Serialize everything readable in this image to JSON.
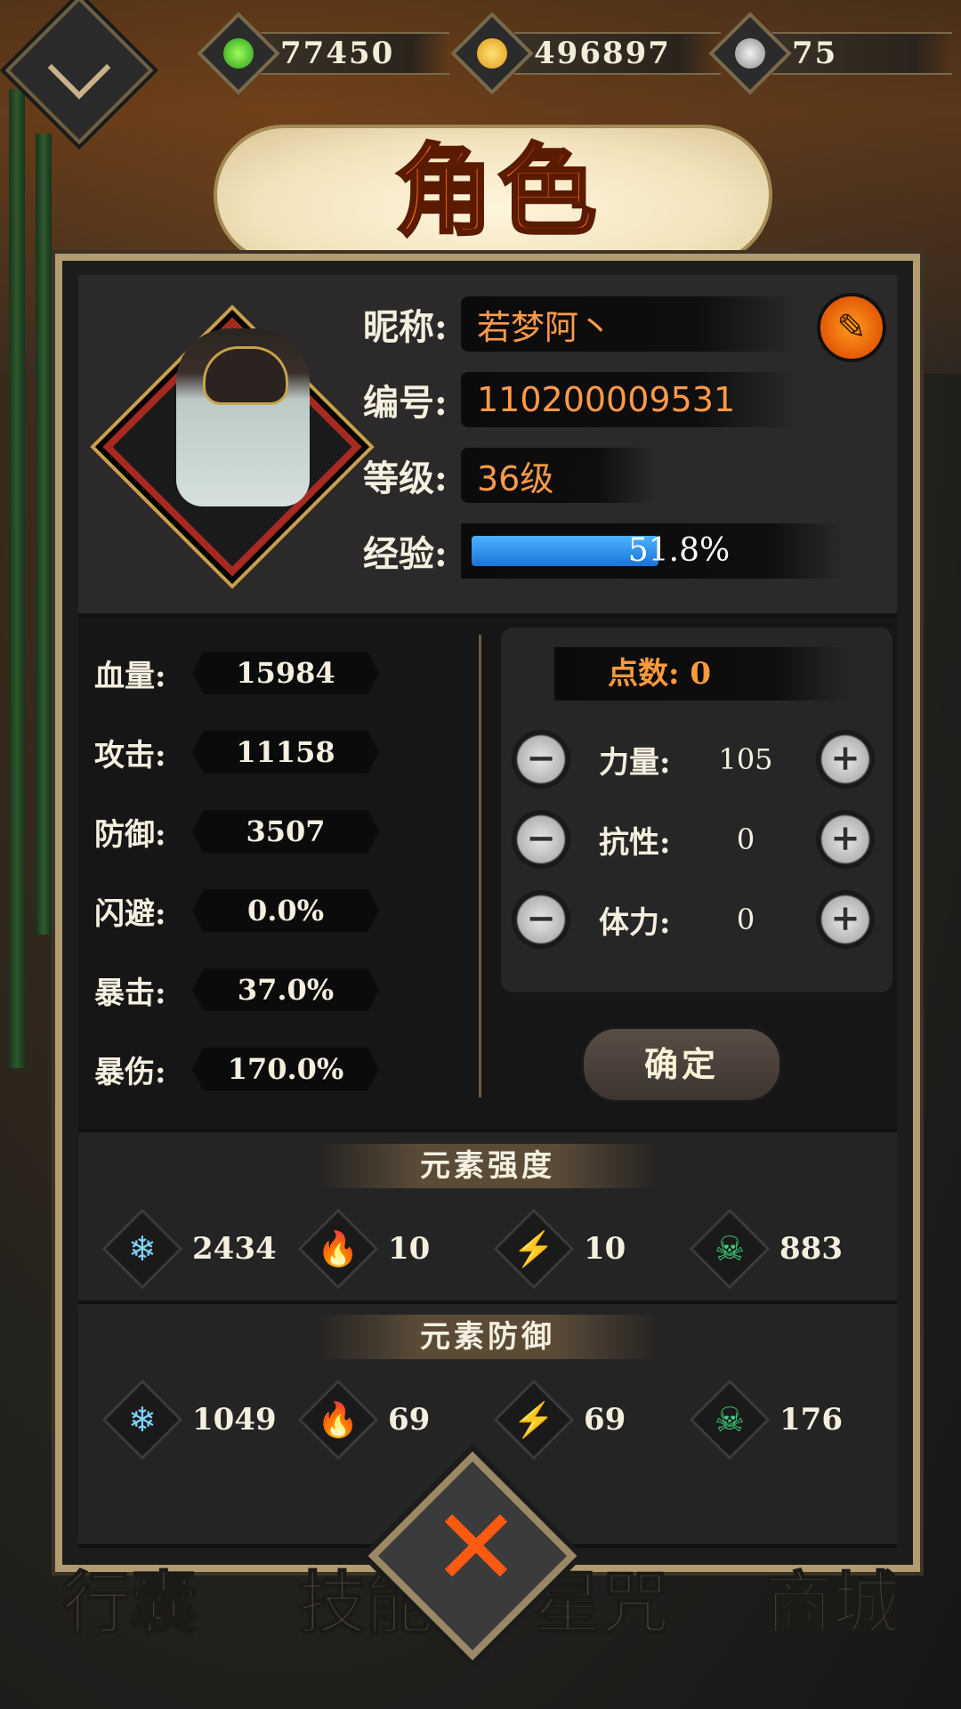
{
  "currency": {
    "jade": {
      "icon": "green-drop-icon",
      "value": "77450"
    },
    "gold": {
      "icon": "gold-coin-icon",
      "value": "496897"
    },
    "silver": {
      "icon": "silver-swirl-icon",
      "value": "75"
    }
  },
  "title": "角色",
  "profile": {
    "nickname_label": "昵称:",
    "nickname": "若梦阿丶",
    "id_label": "编号:",
    "id": "110200009531",
    "level_label": "等级:",
    "level": "36级",
    "exp_label": "经验:",
    "exp_text": "51.8%",
    "exp_fraction": 0.518
  },
  "stats": [
    {
      "label": "血量:",
      "value": "15984"
    },
    {
      "label": "攻击:",
      "value": "11158"
    },
    {
      "label": "防御:",
      "value": "3507"
    },
    {
      "label": "闪避:",
      "value": "0.0%"
    },
    {
      "label": "暴击:",
      "value": "37.0%"
    },
    {
      "label": "暴伤:",
      "value": "170.0%"
    }
  ],
  "points": {
    "header": "点数: 0",
    "rows": [
      {
        "label": "力量:",
        "value": "105"
      },
      {
        "label": "抗性:",
        "value": "0"
      },
      {
        "label": "体力:",
        "value": "0"
      }
    ],
    "minus": "−",
    "plus": "+",
    "confirm": "确定"
  },
  "element_strength": {
    "title": "元素强度",
    "items": [
      {
        "icon": "ice-snowflake-icon",
        "glyph": "❄",
        "color": "#7fd4ff",
        "value": "2434"
      },
      {
        "icon": "fire-flame-icon",
        "glyph": "🔥",
        "color": "#ff9a2a",
        "value": "10"
      },
      {
        "icon": "lightning-bolt-icon",
        "glyph": "⚡",
        "color": "#b07cff",
        "value": "10"
      },
      {
        "icon": "poison-skull-icon",
        "glyph": "☠",
        "color": "#3fd27a",
        "value": "883"
      }
    ]
  },
  "element_defense": {
    "title": "元素防御",
    "items": [
      {
        "icon": "ice-snowflake-icon",
        "glyph": "❄",
        "color": "#7fd4ff",
        "value": "1049"
      },
      {
        "icon": "fire-flame-icon",
        "glyph": "🔥",
        "color": "#ff9a2a",
        "value": "69"
      },
      {
        "icon": "lightning-bolt-icon",
        "glyph": "⚡",
        "color": "#b07cff",
        "value": "69"
      },
      {
        "icon": "poison-skull-icon",
        "glyph": "☠",
        "color": "#3fd27a",
        "value": "176"
      }
    ]
  },
  "close_glyph": "✕",
  "bottom_tabs": [
    "行囊",
    "技能",
    "星咒",
    "商城"
  ]
}
